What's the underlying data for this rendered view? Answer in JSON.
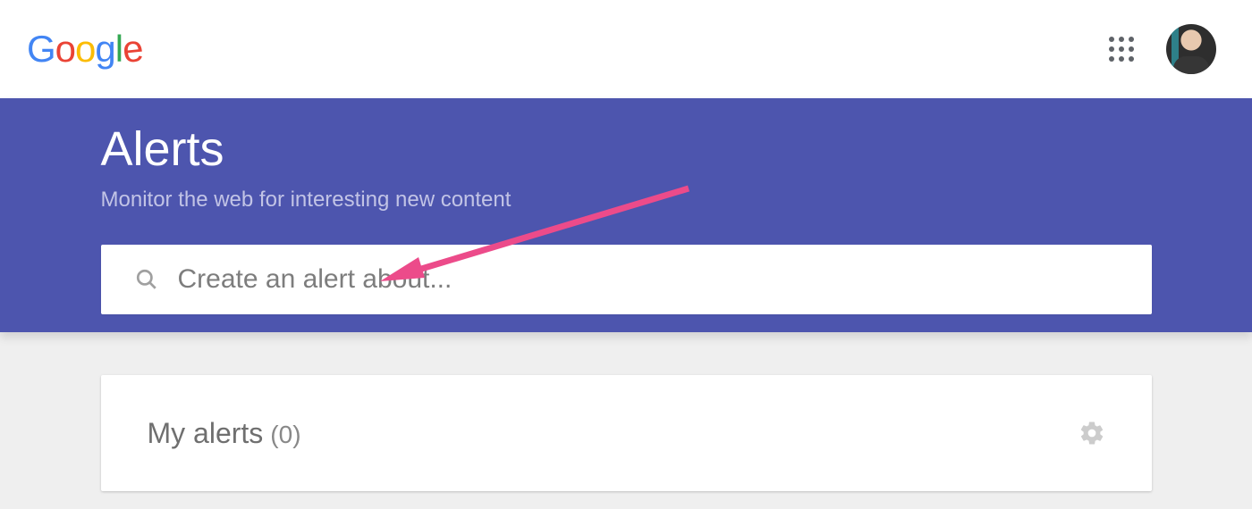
{
  "header": {
    "logo_text": "Google",
    "logo_letters": [
      "G",
      "o",
      "o",
      "g",
      "l",
      "e"
    ]
  },
  "hero": {
    "title": "Alerts",
    "subtitle": "Monitor the web for interesting new content"
  },
  "search": {
    "placeholder": "Create an alert about...",
    "value": ""
  },
  "alerts_panel": {
    "label": "My alerts",
    "count_text": "(0)"
  }
}
